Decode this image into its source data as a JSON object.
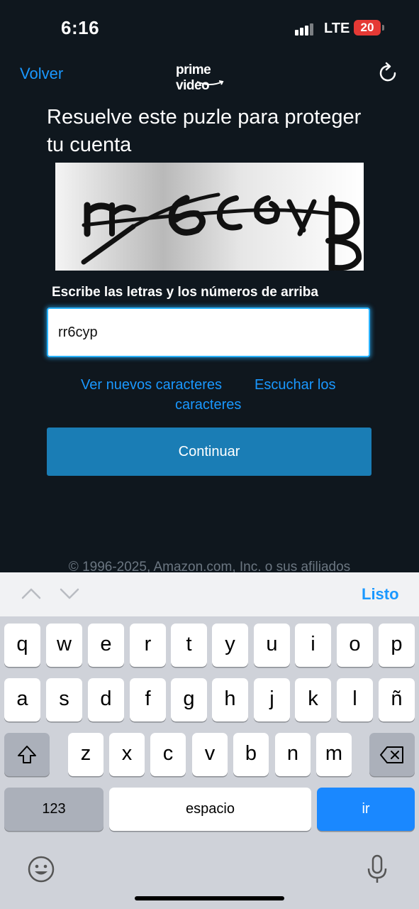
{
  "status_bar": {
    "time": "6:16",
    "network": "LTE",
    "battery": "20"
  },
  "nav": {
    "back_label": "Volver",
    "logo_text": "prime video"
  },
  "puzzle": {
    "title": "Resuelve este puzle para proteger tu cuenta",
    "input_label": "Escribe las letras y los números de arriba",
    "input_value": "rr6cyp",
    "new_chars_label": "Ver nuevos caracteres",
    "listen_label_1": "Escuchar los",
    "listen_label_2": "caracteres",
    "continue_label": "Continuar"
  },
  "footer": {
    "copyright": "© 1996-2025, Amazon.com, Inc. o sus afiliados"
  },
  "keyboard": {
    "done_label": "Listo",
    "row1": [
      "q",
      "w",
      "e",
      "r",
      "t",
      "y",
      "u",
      "i",
      "o",
      "p"
    ],
    "row2": [
      "a",
      "s",
      "d",
      "f",
      "g",
      "h",
      "j",
      "k",
      "l",
      "ñ"
    ],
    "row3": [
      "z",
      "x",
      "c",
      "v",
      "b",
      "n",
      "m"
    ],
    "numbers_label": "123",
    "space_label": "espacio",
    "go_label": "ir"
  },
  "icons": [
    "refresh-icon",
    "chevron-up-icon",
    "chevron-down-icon",
    "shift-icon",
    "backspace-icon",
    "emoji-icon",
    "microphone-icon"
  ],
  "colors": {
    "background": "#0f171e",
    "link": "#1a98ff",
    "button": "#1a7db5",
    "battery": "#e53935"
  }
}
